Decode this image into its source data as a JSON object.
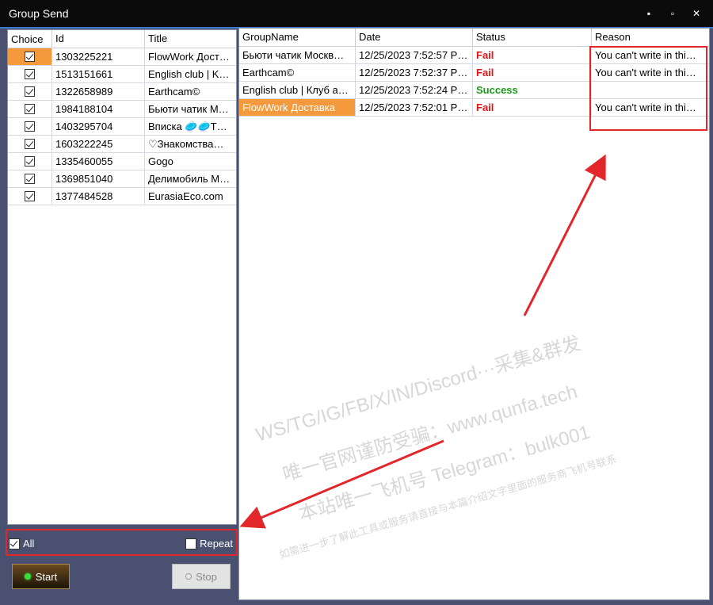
{
  "window": {
    "title": "Group Send",
    "minimize": "▪",
    "maximize": "▫",
    "close": "✕"
  },
  "left_table": {
    "headers": {
      "choice": "Choice",
      "id": "Id",
      "title": "Title"
    },
    "rows": [
      {
        "checked": true,
        "id": "1303225221",
        "title": "FlowWork Дост…"
      },
      {
        "checked": true,
        "id": "1513151661",
        "title": "English club | K…"
      },
      {
        "checked": true,
        "id": "1322658989",
        "title": "Earthcam©"
      },
      {
        "checked": true,
        "id": "1984188104",
        "title": "Бьюти чатик М…"
      },
      {
        "checked": true,
        "id": "1403295704",
        "title": "Вписка 🥏🥏T…"
      },
      {
        "checked": true,
        "id": "1603222245",
        "title": "♡Знакомства…"
      },
      {
        "checked": true,
        "id": "1335460055",
        "title": "Gogo"
      },
      {
        "checked": true,
        "id": "1369851040",
        "title": "Делимобиль М…"
      },
      {
        "checked": true,
        "id": "1377484528",
        "title": "EurasiaEco.com"
      }
    ]
  },
  "options": {
    "all_label": "All",
    "all_checked": true,
    "repeat_label": "Repeat",
    "repeat_checked": false
  },
  "buttons": {
    "start_label": "Start",
    "stop_label": "Stop"
  },
  "right_table": {
    "headers": {
      "group_name": "GroupName",
      "date": "Date",
      "status": "Status",
      "reason": "Reason"
    },
    "rows": [
      {
        "group_name": "Бьюти чатик Москв…",
        "date": "12/25/2023 7:52:57 P…",
        "status": "Fail",
        "reason": "You can't write in thi…"
      },
      {
        "group_name": "Earthcam©",
        "date": "12/25/2023 7:52:37 P…",
        "status": "Fail",
        "reason": "You can't write in thi…"
      },
      {
        "group_name": "English club | Клуб а…",
        "date": "12/25/2023 7:52:24 P…",
        "status": "Success",
        "reason": ""
      },
      {
        "group_name": "FlowWork Доставка",
        "date": "12/25/2023 7:52:01 P…",
        "status": "Fail",
        "reason": "You can't write in thi…"
      }
    ]
  },
  "watermark": {
    "line1": "WS/TG/IG/FB/X/IN/Discord···采集&群发",
    "line2": "唯一官网谨防受骗：www.qunfa.tech",
    "line3": "本站唯一飞机号 Telegram：bulk001",
    "line4": "如需进一步了解此工具或服务请直接与本篇介绍文字里面的服务商飞机号联系"
  },
  "colors": {
    "accent": "#3a78c8",
    "selection": "#f49a3c",
    "fail": "#e01515",
    "success": "#1a9a1a",
    "highlight": "#e3262a"
  }
}
